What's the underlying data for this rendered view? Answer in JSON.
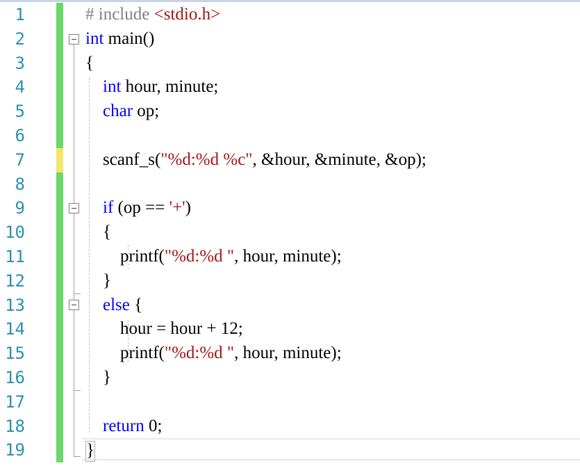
{
  "editor": {
    "line_numbers": [
      "1",
      "2",
      "3",
      "4",
      "5",
      "6",
      "7",
      "8",
      "9",
      "10",
      "11",
      "12",
      "13",
      "14",
      "15",
      "16",
      "17",
      "18",
      "19"
    ],
    "lines": {
      "l1": {
        "hash": "# include",
        "header": "<stdio.h>"
      },
      "l2": {
        "kw": "int",
        "rest": " main()"
      },
      "l3": {
        "text": "{"
      },
      "l4": {
        "indent": "    ",
        "kw": "int",
        "rest": " hour, minute;"
      },
      "l5": {
        "indent": "    ",
        "kw": "char",
        "rest": " op;"
      },
      "l6": {
        "text": ""
      },
      "l7": {
        "pre": "    scanf_s(",
        "str": "\"%d:%d %c\"",
        "post": ", &hour, &minute, &op);"
      },
      "l8": {
        "text": ""
      },
      "l9": {
        "indent": "    ",
        "kw": "if",
        "pre": " (op == ",
        "str": "'+'",
        "post": ")"
      },
      "l10": {
        "text": "    {"
      },
      "l11": {
        "pre": "        printf(",
        "str": "\"%d:%d \"",
        "post": ", hour, minute);"
      },
      "l12": {
        "text": "    }"
      },
      "l13": {
        "indent": "    ",
        "kw": "else",
        "rest": " {"
      },
      "l14": {
        "text": "        hour = hour + 12;"
      },
      "l15": {
        "pre": "        printf(",
        "str": "\"%d:%d \"",
        "post": ", hour, minute);"
      },
      "l16": {
        "text": "    }"
      },
      "l17": {
        "text": ""
      },
      "l18": {
        "indent": "    ",
        "kw": "return",
        "rest": " 0;"
      },
      "l19": {
        "text": "}"
      }
    },
    "change_markers": [
      "saved",
      "saved",
      "saved",
      "saved",
      "saved",
      "saved",
      "unsaved",
      "saved",
      "saved",
      "saved",
      "saved",
      "saved",
      "saved",
      "saved",
      "saved",
      "saved",
      "saved",
      "saved",
      "saved"
    ]
  },
  "colors": {
    "line_number": "#2b91af",
    "keyword": "#0000ff",
    "string": "#a31515",
    "preprocessor": "#808080",
    "saved_marker": "#6ad86a",
    "unsaved_marker": "#f2e56b"
  }
}
